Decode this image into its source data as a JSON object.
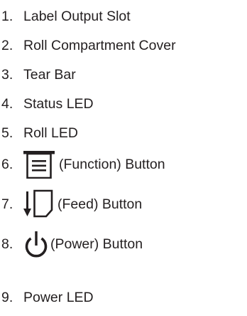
{
  "items": [
    {
      "number": "1.",
      "label": "Label Output Slot"
    },
    {
      "number": "2.",
      "label": "Roll Compartment Cover"
    },
    {
      "number": "3.",
      "label": "Tear Bar"
    },
    {
      "number": "4.",
      "label": "Status LED"
    },
    {
      "number": "5.",
      "label": "Roll LED"
    },
    {
      "number": "6.",
      "label": "(Function) Button",
      "icon": "function-menu-icon"
    },
    {
      "number": "7.",
      "label": "(Feed) Button",
      "icon": "feed-icon"
    },
    {
      "number": "8.",
      "label": "(Power) Button",
      "icon": "power-icon"
    },
    {
      "number": "9.",
      "label": "Power LED"
    }
  ],
  "colors": {
    "text": "#231f20"
  }
}
